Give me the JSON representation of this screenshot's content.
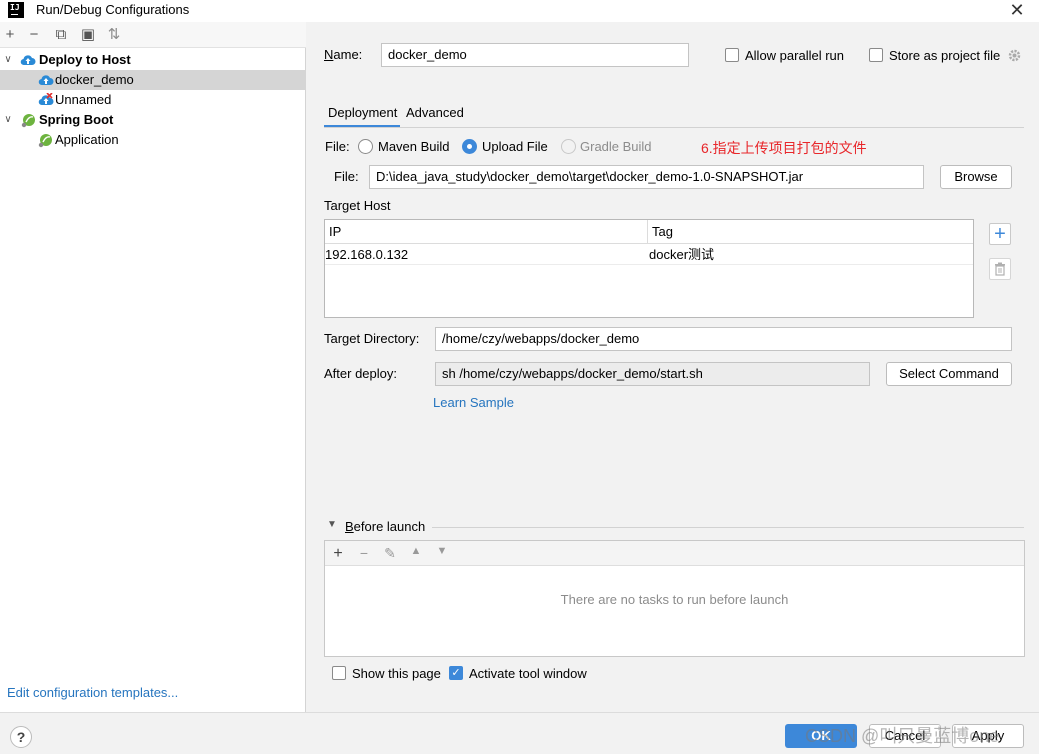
{
  "window": {
    "title": "Run/Debug Configurations",
    "logo_text": "IJ"
  },
  "toolbar": {
    "add": "+",
    "remove": "−",
    "copy": "⧉",
    "folder": "▣",
    "sort": "⇅"
  },
  "tree": {
    "deploy_group": "Deploy to Host",
    "docker_demo": "docker_demo",
    "unnamed": "Unnamed",
    "spring_group": "Spring Boot",
    "application": "Application"
  },
  "edit_templates": "Edit configuration templates...",
  "form": {
    "name_label": "Name:",
    "name_value": "docker_demo",
    "allow_parallel": "Allow parallel run",
    "store_project": "Store as project file",
    "tabs": [
      "Deployment",
      "Advanced"
    ],
    "file_label": "File:",
    "maven_build": "Maven Build",
    "upload_file": "Upload File",
    "gradle_build": "Gradle Build",
    "annotation": "6.指定上传项目打包的文件",
    "file_path_label": "File:",
    "file_path": "D:\\idea_java_study\\docker_demo\\target\\docker_demo-1.0-SNAPSHOT.jar",
    "browse": "Browse",
    "target_host": "Target Host",
    "table_headers": {
      "ip": "IP",
      "tag": "Tag"
    },
    "table_rows": [
      {
        "ip": "192.168.0.132",
        "tag": "docker测试"
      }
    ],
    "target_dir_label": "Target Directory:",
    "target_dir": "/home/czy/webapps/docker_demo",
    "after_deploy_label": "After deploy:",
    "after_deploy": "sh /home/czy/webapps/docker_demo/start.sh",
    "select_command": "Select Command",
    "learn_sample": "Learn Sample",
    "before_launch": "Before launch",
    "no_tasks": "There are no tasks to run before launch",
    "show_page": "Show this page",
    "activate_tool": "Activate tool window"
  },
  "bottom": {
    "help": "?",
    "ok": "OK",
    "cancel": "Cancel",
    "apply": "Apply",
    "watermark": "CSDN @叫只曼蓝博one"
  },
  "colors": {
    "accent": "#3d88d9",
    "link": "#2675bf",
    "annotation": "#e8262a",
    "selected_row": "#d5d5d5"
  }
}
